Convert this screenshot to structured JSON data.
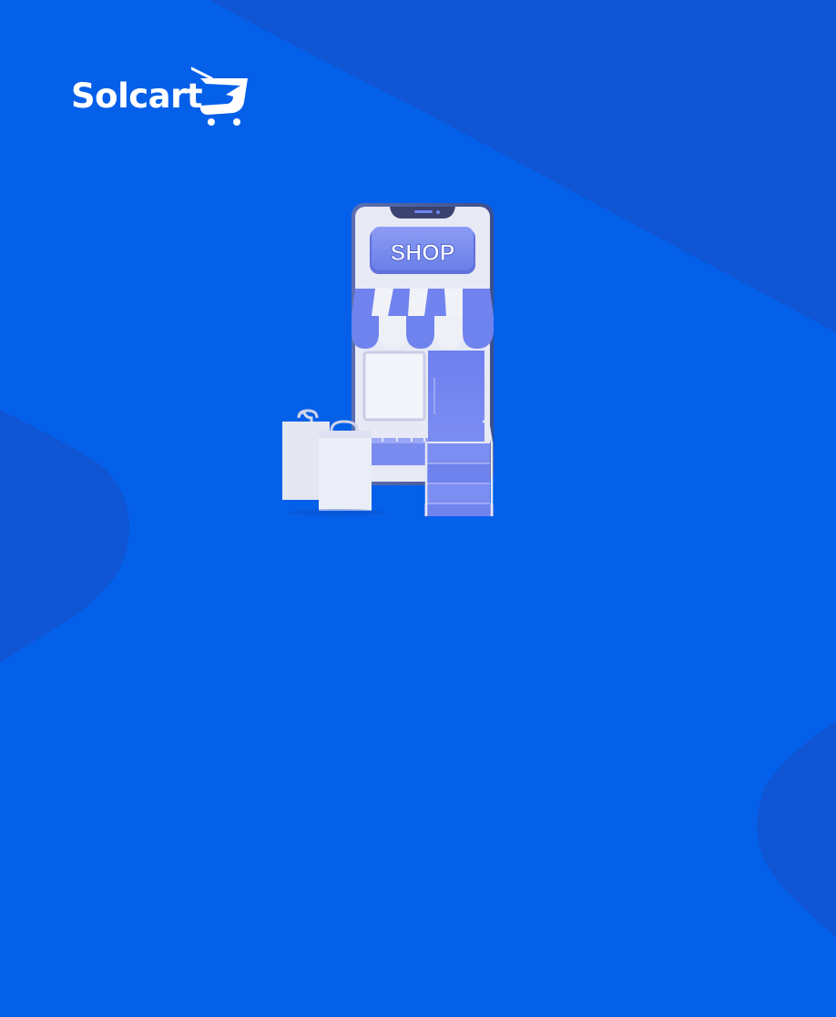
{
  "brand": {
    "name": "Solcart",
    "logo_icon": "shopping-cart-icon"
  },
  "illustration": {
    "sign_text": "SHOP"
  },
  "colors": {
    "background": "#0560e9",
    "background_shape": "#0f55d4",
    "accent_periwinkle": "#6f85f0",
    "light_gray": "#e6e8f3"
  }
}
